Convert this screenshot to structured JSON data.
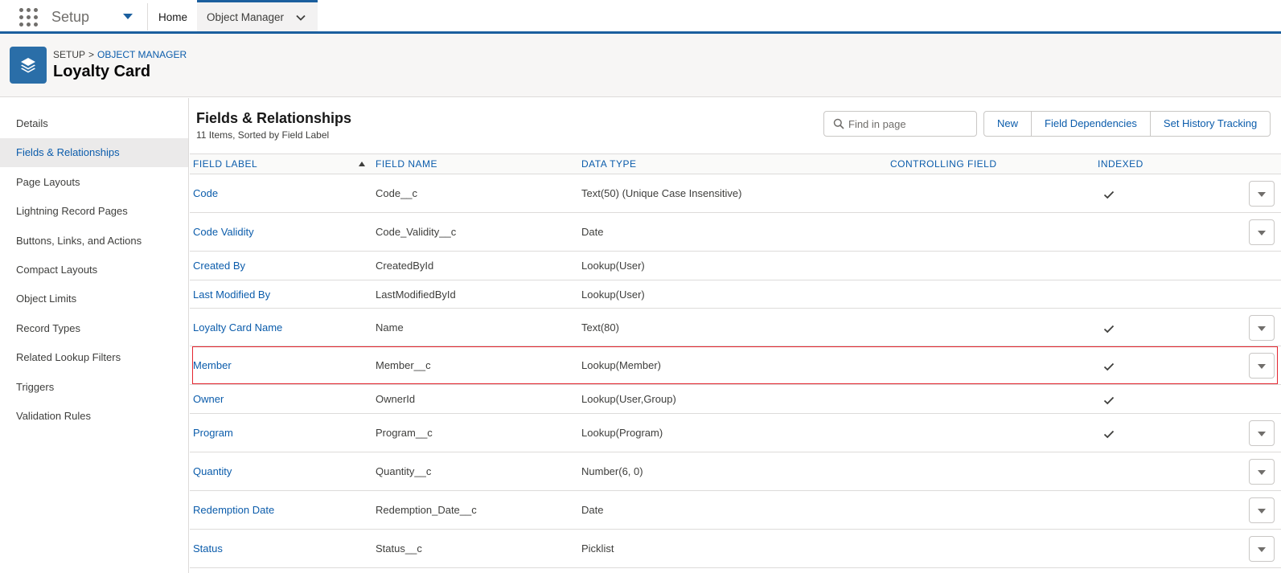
{
  "topnav": {
    "app_name": "Setup",
    "home_label": "Home",
    "active_tab_label": "Object Manager"
  },
  "header": {
    "breadcrumb_root": "SETUP",
    "breadcrumb_separator": ">",
    "breadcrumb_link": "OBJECT MANAGER",
    "title": "Loyalty Card"
  },
  "sidebar": {
    "items": [
      {
        "label": "Details"
      },
      {
        "label": "Fields & Relationships"
      },
      {
        "label": "Page Layouts"
      },
      {
        "label": "Lightning Record Pages"
      },
      {
        "label": "Buttons, Links, and Actions"
      },
      {
        "label": "Compact Layouts"
      },
      {
        "label": "Object Limits"
      },
      {
        "label": "Record Types"
      },
      {
        "label": "Related Lookup Filters"
      },
      {
        "label": "Triggers"
      },
      {
        "label": "Validation Rules"
      }
    ],
    "active_index": 1
  },
  "section": {
    "title": "Fields & Relationships",
    "subtitle": "11 Items, Sorted by Field Label",
    "search_placeholder": "Find in page",
    "buttons": [
      "New",
      "Field Dependencies",
      "Set History Tracking"
    ]
  },
  "table": {
    "columns": [
      "FIELD LABEL",
      "FIELD NAME",
      "DATA TYPE",
      "CONTROLLING FIELD",
      "INDEXED"
    ],
    "sorted_column": "FIELD LABEL",
    "sort_direction": "ascending",
    "rows": [
      {
        "label": "Code",
        "name": "Code__c",
        "type": "Text(50) (Unique Case Insensitive)",
        "controlling": "",
        "indexed": true,
        "menu": true
      },
      {
        "label": "Code Validity",
        "name": "Code_Validity__c",
        "type": "Date",
        "controlling": "",
        "indexed": false,
        "menu": true
      },
      {
        "label": "Created By",
        "name": "CreatedById",
        "type": "Lookup(User)",
        "controlling": "",
        "indexed": false,
        "menu": false
      },
      {
        "label": "Last Modified By",
        "name": "LastModifiedById",
        "type": "Lookup(User)",
        "controlling": "",
        "indexed": false,
        "menu": false
      },
      {
        "label": "Loyalty Card Name",
        "name": "Name",
        "type": "Text(80)",
        "controlling": "",
        "indexed": true,
        "menu": true
      },
      {
        "label": "Member",
        "name": "Member__c",
        "type": "Lookup(Member)",
        "controlling": "",
        "indexed": true,
        "menu": true,
        "highlighted": true
      },
      {
        "label": "Owner",
        "name": "OwnerId",
        "type": "Lookup(User,Group)",
        "controlling": "",
        "indexed": true,
        "menu": false
      },
      {
        "label": "Program",
        "name": "Program__c",
        "type": "Lookup(Program)",
        "controlling": "",
        "indexed": true,
        "menu": true
      },
      {
        "label": "Quantity",
        "name": "Quantity__c",
        "type": "Number(6, 0)",
        "controlling": "",
        "indexed": false,
        "menu": true
      },
      {
        "label": "Redemption Date",
        "name": "Redemption_Date__c",
        "type": "Date",
        "controlling": "",
        "indexed": false,
        "menu": true
      },
      {
        "label": "Status",
        "name": "Status__c",
        "type": "Picklist",
        "controlling": "",
        "indexed": false,
        "menu": true
      }
    ]
  },
  "icons": {
    "app_launcher": "app-launcher-grid-icon",
    "object": "layers-icon",
    "search": "search-icon",
    "check": "check-icon",
    "row_menu": "chevron-down-icon"
  },
  "colors": {
    "brand": "#1b5f9e",
    "link": "#0b5cab",
    "object_icon_bg": "#2a6ea8",
    "highlight_border": "#e4252f"
  }
}
